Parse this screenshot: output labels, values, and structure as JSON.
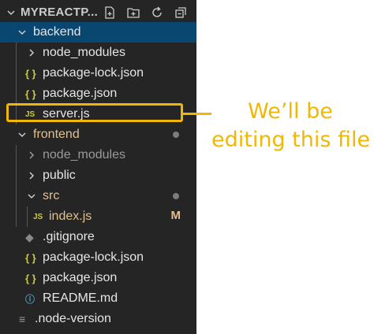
{
  "explorer": {
    "title": "MYREACTP...",
    "actions": [
      "new-file-icon",
      "new-folder-icon",
      "refresh-icon",
      "collapse-all-icon"
    ],
    "items": [
      {
        "label": "backend",
        "type": "folder",
        "expanded": true
      },
      {
        "label": "node_modules",
        "type": "folder",
        "expanded": false
      },
      {
        "label": "package-lock.json",
        "type": "json",
        "icon_text": "{ }"
      },
      {
        "label": "package.json",
        "type": "json",
        "icon_text": "{ }"
      },
      {
        "label": "server.js",
        "type": "js",
        "icon_text": "JS"
      },
      {
        "label": "frontend",
        "type": "folder",
        "expanded": true,
        "status": "modified-dot"
      },
      {
        "label": "node_modules",
        "type": "folder",
        "expanded": false
      },
      {
        "label": "public",
        "type": "folder",
        "expanded": false
      },
      {
        "label": "src",
        "type": "folder",
        "expanded": true,
        "status": "modified-dot"
      },
      {
        "label": "index.js",
        "type": "js",
        "icon_text": "JS",
        "badge": "M"
      },
      {
        "label": ".gitignore",
        "type": "git",
        "icon_text": "◆"
      },
      {
        "label": "package-lock.json",
        "type": "json",
        "icon_text": "{ }"
      },
      {
        "label": "package.json",
        "type": "json",
        "icon_text": "{ }"
      },
      {
        "label": "README.md",
        "type": "info",
        "icon_text": "ⓘ"
      },
      {
        "label": ".node-version",
        "type": "text",
        "icon_text": "≡"
      }
    ]
  },
  "callout": {
    "line1": "We’ll be",
    "line2": "editing this file"
  },
  "colors": {
    "background": "#252526",
    "selection": "#094771",
    "highlight": "#f2b705",
    "modified": "#e2c08d"
  }
}
